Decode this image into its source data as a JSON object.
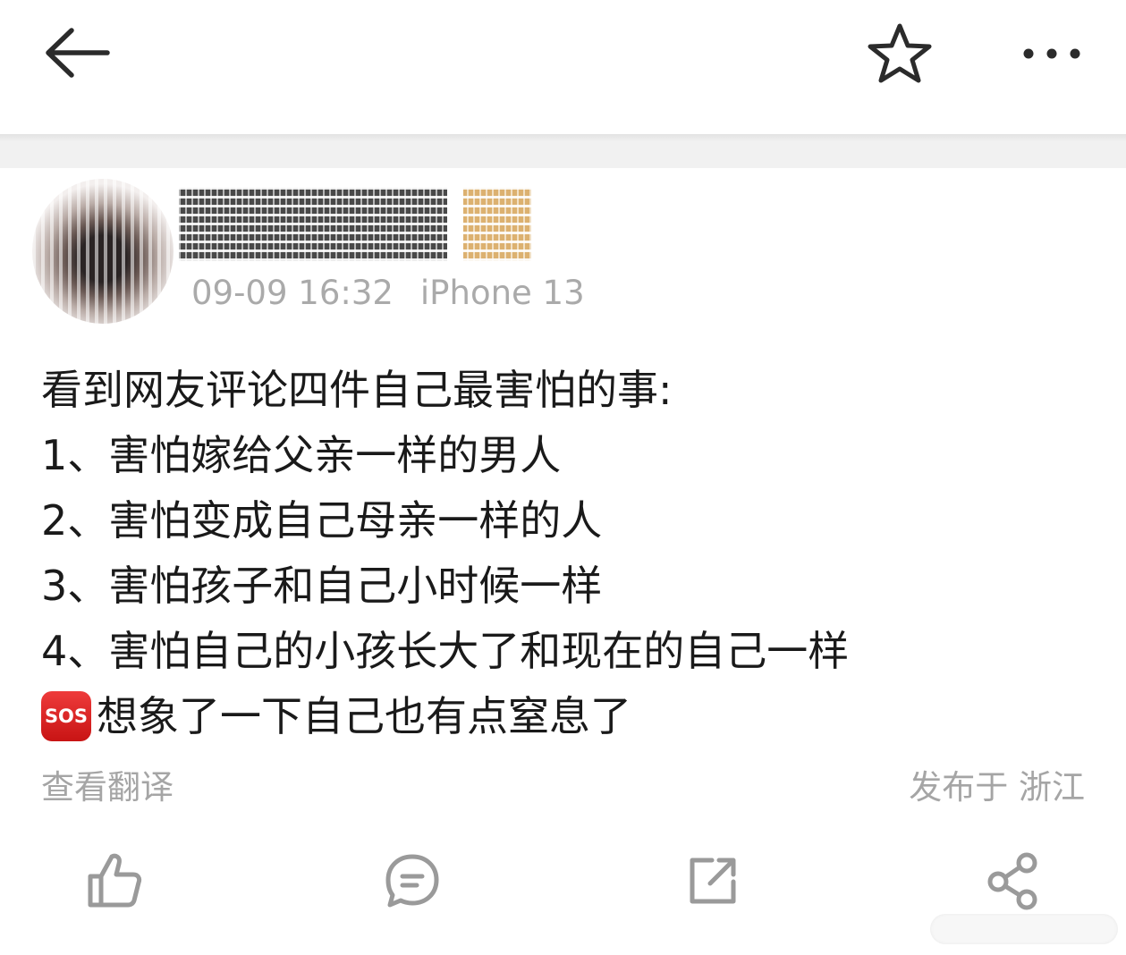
{
  "header": {
    "back_icon": "arrow-left-icon",
    "favorite_icon": "star-outline-icon",
    "more_icon": "more-horizontal-icon"
  },
  "post": {
    "timestamp": "09-09 16:32",
    "device": "iPhone 13",
    "lines": [
      "看到网友评论四件自己最害怕的事:",
      "1、害怕嫁给父亲一样的男人",
      "2、害怕变成自己母亲一样的人",
      "3、害怕孩子和自己小时候一样",
      "4、害怕自己的小孩长大了和现在的自己一样"
    ],
    "emoji_label": "SOS",
    "last_line": "想象了一下自己也有点窒息了",
    "translate_label": "查看翻译",
    "location_label": "发布于 浙江"
  },
  "actions": {
    "like_icon": "thumbs-up-icon",
    "comment_icon": "comment-icon",
    "repost_icon": "repost-icon",
    "share_icon": "share-icon"
  },
  "colors": {
    "text": "#1a1a1a",
    "muted": "#aaaaaa",
    "icon": "#999999",
    "divider": "#f1f1f1",
    "sos_red": "#d91c1c"
  }
}
